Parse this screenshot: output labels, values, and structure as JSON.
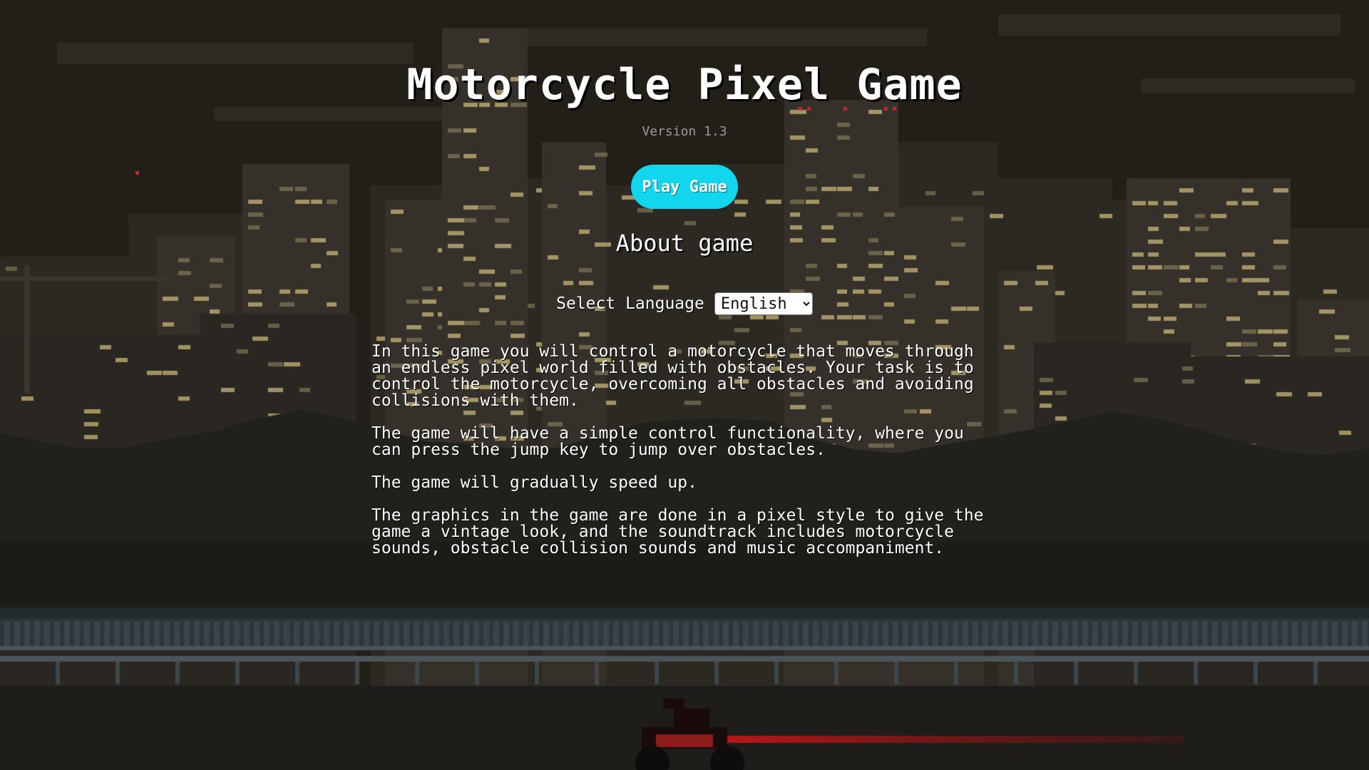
{
  "app": {
    "title": "Motorcycle Pixel Game",
    "version": "Version 1.3"
  },
  "menu": {
    "play_label": "Play Game",
    "about_heading": "About game",
    "language_label": "Select Language",
    "language_selected": "English",
    "language_options": [
      "English"
    ]
  },
  "about": {
    "paragraphs": [
      "In this game you will control a motorcycle that moves through an endless pixel world filled with obstacles. Your task is to control the motorcycle, overcoming all obstacles and avoiding collisions with them.",
      "The game will have a simple control functionality, where you can press the jump key to jump over obstacles.",
      "The game will gradually speed up.",
      "The graphics in the game are done in a pixel style to give the game a vintage look, and the soundtrack includes motorcycle sounds, obstacle collision sounds and music accompaniment."
    ]
  },
  "colors": {
    "accent": "#12d6ee",
    "sky": "#221f19",
    "window_light": "#c8b67a",
    "trail": "#b81818"
  },
  "icons": {
    "dropdown": "chevron-down-icon"
  }
}
